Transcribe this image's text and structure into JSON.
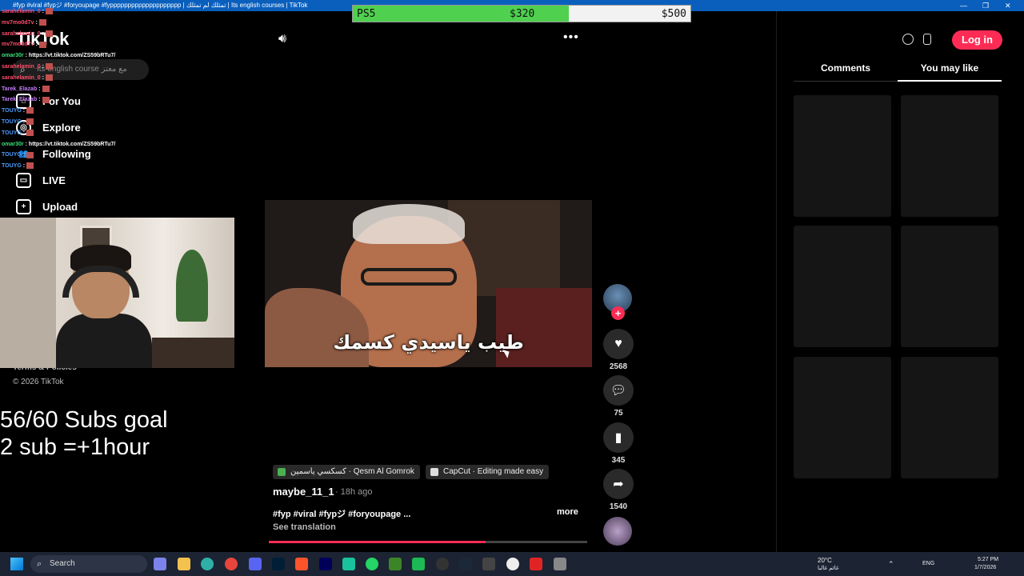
{
  "window": {
    "title": "#fyp #viral #fypジ #foryoupage #fypppppppppppppppppppp | تمثلك لم تمثلك | Its english courses | TikTok"
  },
  "goal": {
    "label": "PS5",
    "current": "$320",
    "target": "$500",
    "progress": 0.64,
    "fill_color": "#4fd14f"
  },
  "sidebar": {
    "logo": "TikTok",
    "search_placeholder": "Its english course مع معتز",
    "items": [
      {
        "label": "For You",
        "icon": "home-icon"
      },
      {
        "label": "Explore",
        "icon": "compass-icon"
      },
      {
        "label": "Following",
        "icon": "people-icon"
      },
      {
        "label": "LIVE",
        "icon": "live-icon"
      },
      {
        "label": "Upload",
        "icon": "plus-square-icon"
      }
    ],
    "footer_terms": "Terms & Policies",
    "footer_copyright": "© 2026 TikTok"
  },
  "chat": [
    {
      "name": "sarahelamin_0",
      "text": ":",
      "color": "#ff4d6d"
    },
    {
      "name": "mv7mo0d7v",
      "text": ":",
      "color": "#ff4d6d"
    },
    {
      "name": "sarahelamin_0",
      "text": ":",
      "color": "#ff4d6d"
    },
    {
      "name": "mv7mo0d7v",
      "text": ":",
      "color": "#ff4d6d"
    },
    {
      "name": "omar30r",
      "text": ": https://vt.tiktok.com/ZS59bRTu7/",
      "color": "#3ee07a"
    },
    {
      "name": "sarahelamin_0",
      "text": ":",
      "color": "#ff4d6d"
    },
    {
      "name": "sarahelamin_0",
      "text": ":",
      "color": "#ff4d6d"
    },
    {
      "name": "Tarek_Elazab",
      "text": ":",
      "color": "#c77dff"
    },
    {
      "name": "Tarek_Elazab",
      "text": ":",
      "color": "#c77dff"
    },
    {
      "name": "TOUYG",
      "text": ":",
      "color": "#4d9bff"
    },
    {
      "name": "TOUYG",
      "text": ":",
      "color": "#4d9bff"
    },
    {
      "name": "TOUYG",
      "text": ":",
      "color": "#4d9bff"
    },
    {
      "name": "omar30r",
      "text": ": https://vt.tiktok.com/ZS59bRTu7/",
      "color": "#3ee07a"
    },
    {
      "name": "TOUYG",
      "text": ":",
      "color": "#4d9bff"
    },
    {
      "name": "TOUYG",
      "text": ":",
      "color": "#4d9bff"
    }
  ],
  "stream_overlay": {
    "subs_goal": "56/60 Subs goal",
    "sub_rule": "2 sub =+1hour"
  },
  "video": {
    "subtitle": "طيب ياسيدي كسمك",
    "author": "maybe_11_1",
    "time": "· 18h ago",
    "caption": "#fyp #viral #fypジ #foryoupage ...",
    "more": "more",
    "see_translation": "See translation",
    "progress": 0.68,
    "chips": [
      {
        "label": "كسكسي ياسمين · Qesm Al Gomrok"
      },
      {
        "label": "CapCut · Editing made easy"
      }
    ]
  },
  "actions": {
    "likes": "2568",
    "comments": "75",
    "saves": "345",
    "shares": "1540"
  },
  "right_panel": {
    "login": "Log in",
    "tabs": [
      {
        "label": "Comments"
      },
      {
        "label": "You may like"
      }
    ]
  },
  "taskbar": {
    "search": "Search",
    "weather_temp": "20°C",
    "weather_desc": "غائم غالبا",
    "lang": "ENG",
    "time": "5:27 PM",
    "date": "1/7/2026"
  }
}
